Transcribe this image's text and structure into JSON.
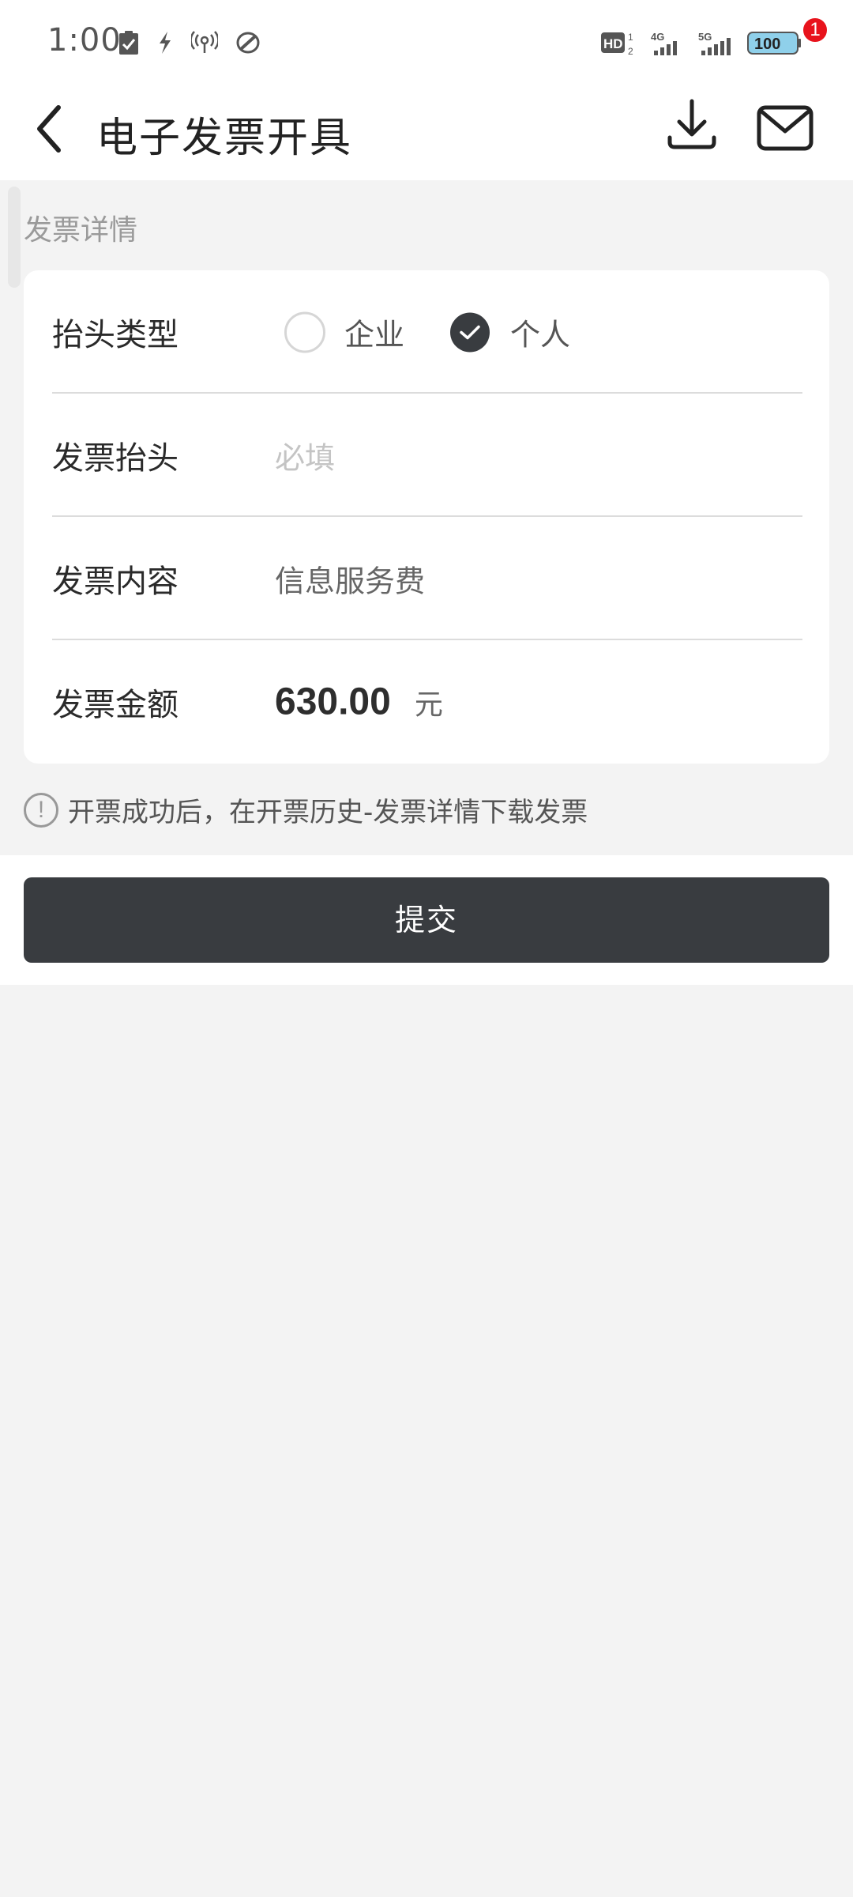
{
  "status_bar": {
    "time": "1:00",
    "battery": "100",
    "network_1": "4G",
    "network_2": "5G",
    "hd_label": "HD",
    "hd_sup": "1",
    "hd_sub": "2"
  },
  "header": {
    "title": "电子发票开具",
    "mail_badge": "1"
  },
  "section": {
    "title": "发票详情"
  },
  "form": {
    "title_type": {
      "label": "抬头类型",
      "options": [
        "企业",
        "个人"
      ],
      "selected": "个人"
    },
    "invoice_title": {
      "label": "发票抬头",
      "placeholder": "必填",
      "value": ""
    },
    "invoice_content": {
      "label": "发票内容",
      "value": "信息服务费"
    },
    "invoice_amount": {
      "label": "发票金额",
      "value": "630.00",
      "unit": "元"
    }
  },
  "notice": {
    "text": "开票成功后，在开票历史-发票详情下载发票"
  },
  "submit": {
    "label": "提交"
  },
  "colors": {
    "primary_button": "#393c40",
    "badge": "#e8131c",
    "background": "#f3f3f3"
  }
}
